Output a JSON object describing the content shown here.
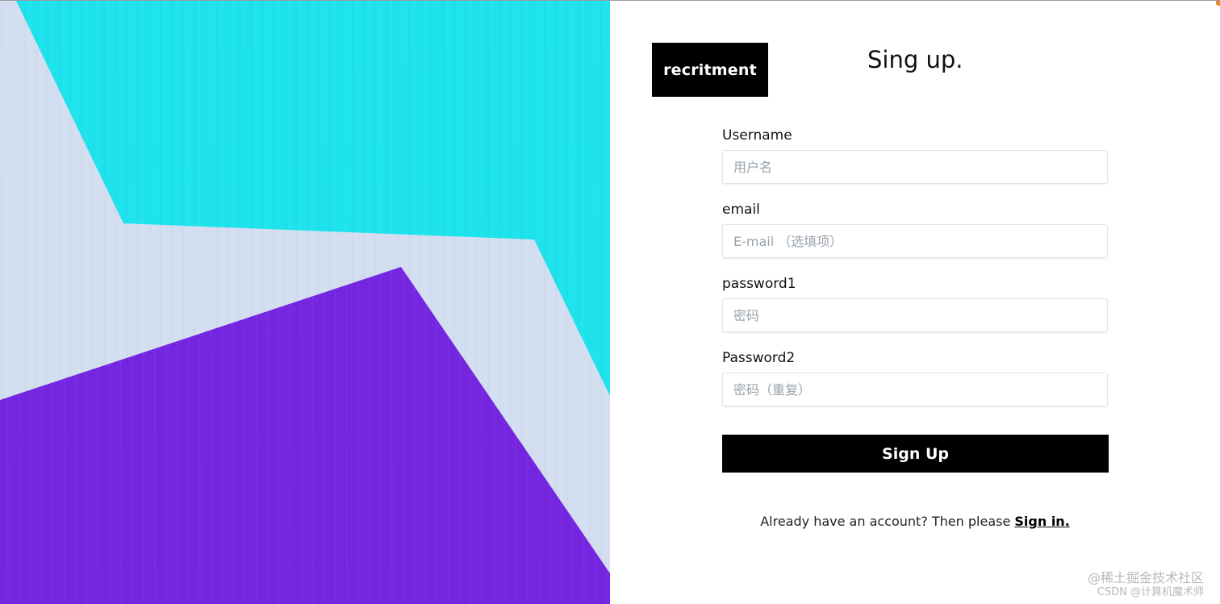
{
  "logo": {
    "text": "recritment"
  },
  "page_title": "Sing up.",
  "form": {
    "fields": [
      {
        "label": "Username",
        "placeholder": "用户名"
      },
      {
        "label": "email",
        "placeholder": "E-mail （选填项）"
      },
      {
        "label": "password1",
        "placeholder": "密码"
      },
      {
        "label": "Password2",
        "placeholder": "密码（重复）"
      }
    ],
    "submit_label": "Sign Up"
  },
  "signin": {
    "prompt": "Already have an account? Then please ",
    "link_label": "Sign in."
  },
  "watermark": {
    "line1": "@稀土掘金技术社区",
    "line2": "CSDN @计算机魔术师"
  },
  "colors": {
    "hero_cyan": "#1ee3ec",
    "hero_light": "#d3def1",
    "hero_purple": "#7526e0",
    "accent_black": "#000000"
  }
}
